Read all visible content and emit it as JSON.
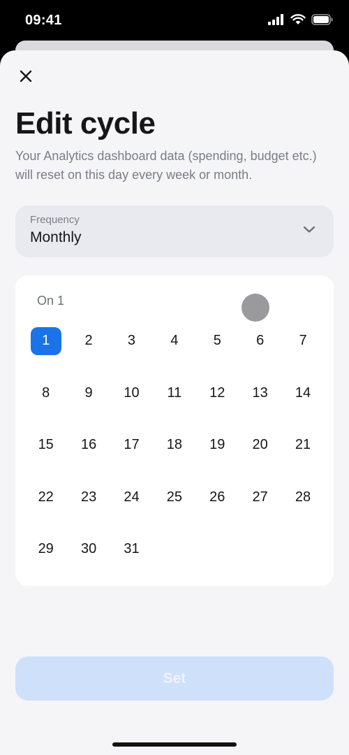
{
  "status_bar": {
    "time": "09:41"
  },
  "sheet": {
    "title": "Edit cycle",
    "subtitle": "Your Analytics dashboard data (spending, budget etc.) will reset on this day every week or month.",
    "frequency": {
      "label": "Frequency",
      "value": "Monthly"
    },
    "calendar": {
      "caption": "On 1",
      "selected_day": "1",
      "days": [
        "1",
        "2",
        "3",
        "4",
        "5",
        "6",
        "7",
        "8",
        "9",
        "10",
        "11",
        "12",
        "13",
        "14",
        "15",
        "16",
        "17",
        "18",
        "19",
        "20",
        "21",
        "22",
        "23",
        "24",
        "25",
        "26",
        "27",
        "28",
        "29",
        "30",
        "31"
      ]
    },
    "set_label": "Set"
  },
  "colors": {
    "accent": "#1a73e8",
    "set_button_disabled": "#cfe0fb",
    "sheet_background": "#f5f5f8"
  }
}
